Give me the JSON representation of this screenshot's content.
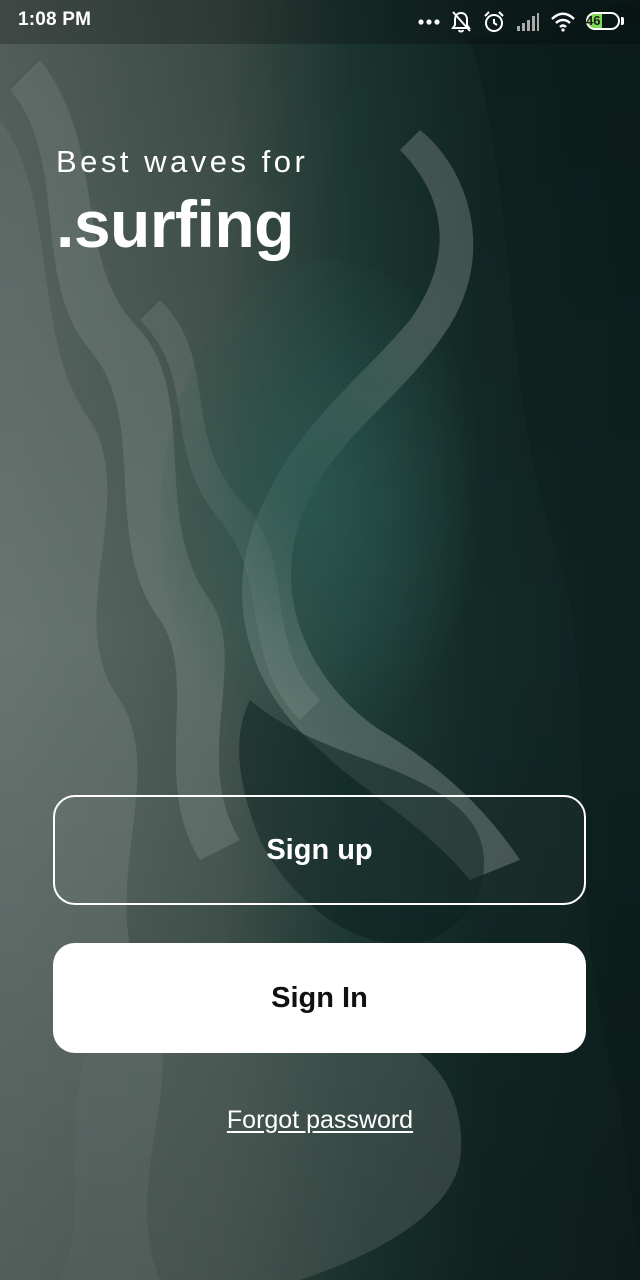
{
  "status_bar": {
    "time": "1:08 PM",
    "battery_level": "46",
    "battery_fraction": 0.46,
    "icons": [
      "more-dots-icon",
      "notifications-off-icon",
      "alarm-icon",
      "signal-icon",
      "wifi-icon",
      "battery-icon"
    ]
  },
  "hero": {
    "tagline": "Best waves for",
    "brand": ".surfing"
  },
  "actions": {
    "sign_up_label": "Sign up",
    "sign_in_label": "Sign In",
    "forgot_password_label": "Forgot password"
  },
  "colors": {
    "background_dark": "#17302c",
    "foam": "#7d8a86",
    "accent_battery": "#7ed957",
    "text": "#ffffff",
    "button_fill": "#ffffff",
    "button_text": "#111111"
  }
}
